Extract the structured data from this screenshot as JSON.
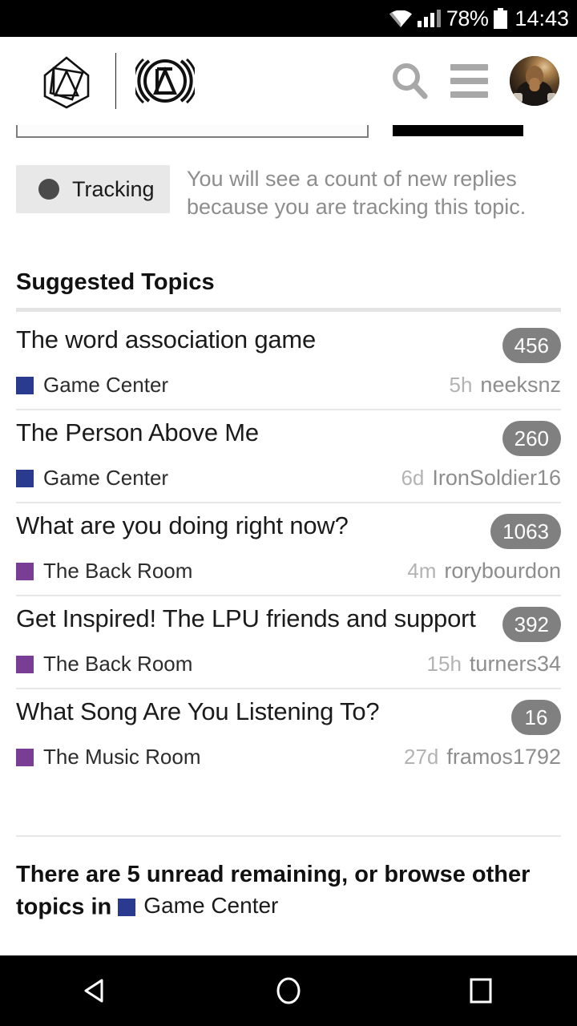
{
  "status_bar": {
    "wifi_icon": "wifi-icon",
    "signal_icon": "cellular-signal-icon",
    "battery_percent": "78%",
    "battery_icon": "battery-icon",
    "time": "14:43"
  },
  "app_bar": {
    "logo_primary": "linkin-park-hex-logo",
    "logo_secondary": "linkin-park-circle-logo",
    "search_icon": "search-icon",
    "menu_icon": "hamburger-menu-icon",
    "avatar": "user-avatar"
  },
  "notice": {
    "chip_label": "Tracking",
    "chip_icon": "circle-dot-icon",
    "description": "You will see a count of new replies because you are tracking this topic."
  },
  "suggested": {
    "heading": "Suggested Topics",
    "topics": [
      {
        "title": "The word association game",
        "count": "456",
        "category": "Game Center",
        "category_color": "#2a3b8f",
        "age": "5h",
        "user": "neeksnz"
      },
      {
        "title": "The Person Above Me",
        "count": "260",
        "category": "Game Center",
        "category_color": "#2a3b8f",
        "age": "6d",
        "user": "IronSoldier16"
      },
      {
        "title": "What are you doing right now?",
        "count": "1063",
        "category": "The Back Room",
        "category_color": "#7a3d96",
        "age": "4m",
        "user": "rorybourdon"
      },
      {
        "title": "Get Inspired! The LPU friends and support",
        "count": "392",
        "category": "The Back Room",
        "category_color": "#7a3d96",
        "age": "15h",
        "user": "turners34"
      },
      {
        "title": "What Song Are You Listening To?",
        "count": "16",
        "category": "The Music Room",
        "category_color": "#7a3d96",
        "age": "27d",
        "user": "framos1792"
      }
    ]
  },
  "footer": {
    "text": "There are 5 unread remaining, or browse other topics in",
    "category": "Game Center",
    "category_color": "#2a3b8f"
  },
  "nav_bar": {
    "back": "back-triangle-icon",
    "home": "home-circle-icon",
    "recents": "recents-square-icon"
  },
  "colors": {
    "badge_gray": "#808080",
    "chip_gray": "#e8e8e8",
    "muted_text": "#8d8d8d"
  }
}
